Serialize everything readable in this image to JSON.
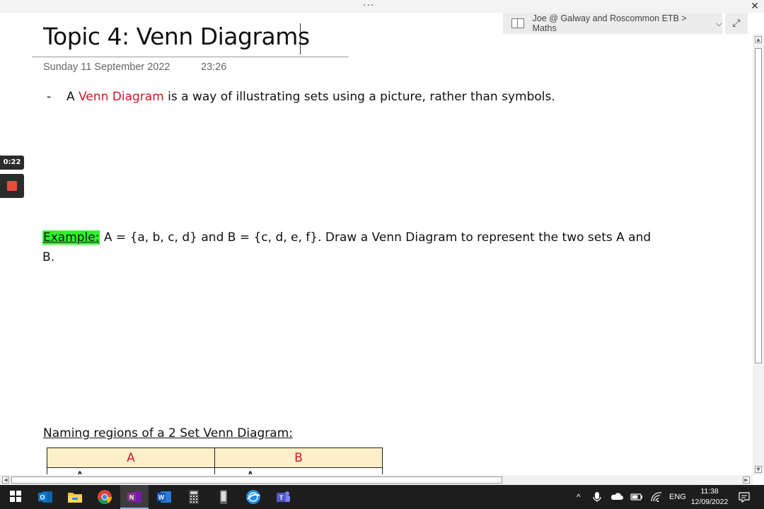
{
  "window": {
    "menu_dots": "···",
    "close_glyph": "✕"
  },
  "notebook": {
    "breadcrumb": "Joe @ Galway and Roscommon ETB > Maths",
    "chevron": "⌵",
    "expand_glyph": "⤢"
  },
  "page": {
    "title": "Topic 4: Venn Diagrams",
    "date": "Sunday 11 September 2022",
    "time": "23:26"
  },
  "bullet": {
    "dash": "-",
    "pre": "A ",
    "highlight": "Venn Diagram",
    "post": " is a way of illustrating sets using a picture, rather than symbols."
  },
  "recording": {
    "timer": "0:22"
  },
  "example": {
    "label": "Example:",
    "text": " A = {a, b, c, d} and B = {c, d, e, f}. Draw a Venn Diagram to represent the two sets A and B."
  },
  "naming": {
    "heading": "Naming regions of a 2 Set Venn Diagram:"
  },
  "table": {
    "headers": [
      "A",
      "B"
    ],
    "row_partial": [
      "A",
      "A"
    ]
  },
  "taskbar": {
    "apps": [
      "outlook-icon",
      "file-explorer-icon",
      "chrome-icon",
      "onenote-icon",
      "word-icon",
      "calculator-icon",
      "phone-icon",
      "browser-icon",
      "teams-icon"
    ],
    "language": "ENG",
    "clock_time": "11:38",
    "clock_date": "12/09/2022"
  },
  "colors": {
    "accent_red": "#d0162b",
    "highlight_green": "#2cf52c",
    "table_header_bg": "#fcefc9"
  }
}
